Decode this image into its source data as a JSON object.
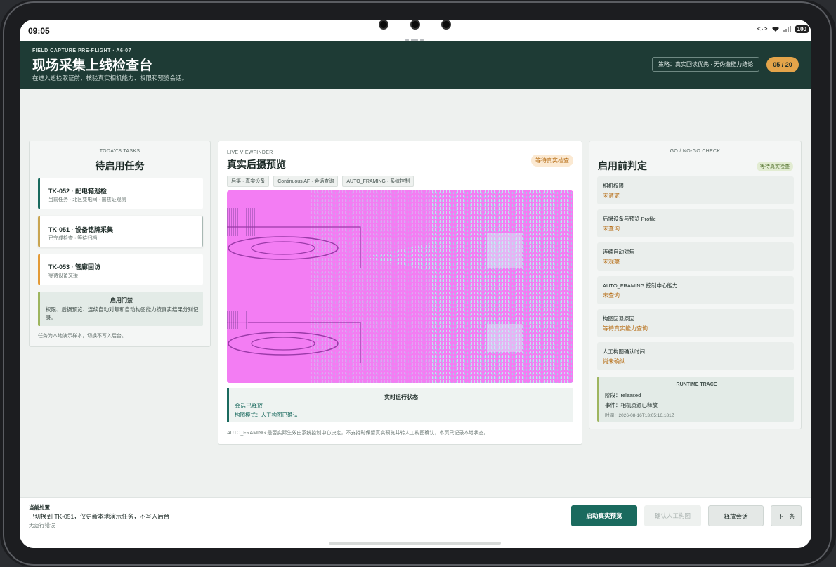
{
  "status": {
    "time": "09:05",
    "battery": "100"
  },
  "header": {
    "kicker": "FIELD CAPTURE PRE-FLIGHT · A6-07",
    "title": "现场采集上线检查台",
    "subtitle": "在进入巡检取证前，核验真实相机能力、权限和预览会话。",
    "strategy": "策略：真实回读优先 · 无伪造能力结论",
    "counter": "05 / 20"
  },
  "tasks": {
    "kicker": "TODAY'S TASKS",
    "title": "待启用任务",
    "items": [
      {
        "title": "TK-052 · 配电箱巡检",
        "sub": "当前任务 · 北区变电间 · 需核证观测"
      },
      {
        "title": "TK-051 · 设备铭牌采集",
        "sub": "已完成检查 · 等待归档"
      },
      {
        "title": "TK-053 · 管廊回访",
        "sub": "等待设备交接"
      }
    ],
    "gate": {
      "title": "启用门禁",
      "text": "权限、后摄预览、连续自动对焦和自动构图能力按真实结果分别记录。"
    },
    "footnote": "任务为本地演示样本，切换不写入后台。"
  },
  "viewfinder": {
    "kicker": "LIVE VIEWFINDER",
    "title": "真实后摄预览",
    "badge": "等待真实检查",
    "chips": [
      "后摄 · 真实设备",
      "Continuous AF · 会话查询",
      "AUTO_FRAMING · 系统控制"
    ],
    "runtime": {
      "title": "实时运行状态",
      "line1": "会话已释放",
      "line2": "构图模式：人工构图已确认"
    },
    "footnote": "AUTO_FRAMING 是否实际生效由系统控制中心决定，不支持时保留真实预览并转人工构图确认，本页只记录本地状态。"
  },
  "checks": {
    "kicker": "GO / NO-GO CHECK",
    "title": "启用前判定",
    "badge": "等待真实检查",
    "items": [
      {
        "label": "相机权限",
        "value": "未请求"
      },
      {
        "label": "后摄设备与预览 Profile",
        "value": "未查询"
      },
      {
        "label": "连续自动对焦",
        "value": "未观察"
      },
      {
        "label": "AUTO_FRAMING 控制中心能力",
        "value": "未查询"
      },
      {
        "label": "构图回退原因",
        "value": "等待真实能力查询"
      },
      {
        "label": "人工构图确认时间",
        "value": "尚未确认"
      }
    ],
    "trace": {
      "title": "RUNTIME TRACE",
      "stage": "阶段：released",
      "event": "事件：相机资源已释放",
      "time": "时间：2026-08-16T13:05:16.181Z"
    }
  },
  "footer": {
    "title": "当前处置",
    "message": "已切换到 TK-051，仅更新本地演示任务，不写入后台",
    "error": "无运行错误",
    "buttons": {
      "start": "启动真实预览",
      "confirm": "确认人工构图",
      "release": "释放会话",
      "next": "下一条"
    }
  },
  "colors": {
    "header_bg": "#1e3b35",
    "accent": "#1a6a5e",
    "amber": "#e4a44a",
    "viewfinder_bg": "#f37df3"
  }
}
